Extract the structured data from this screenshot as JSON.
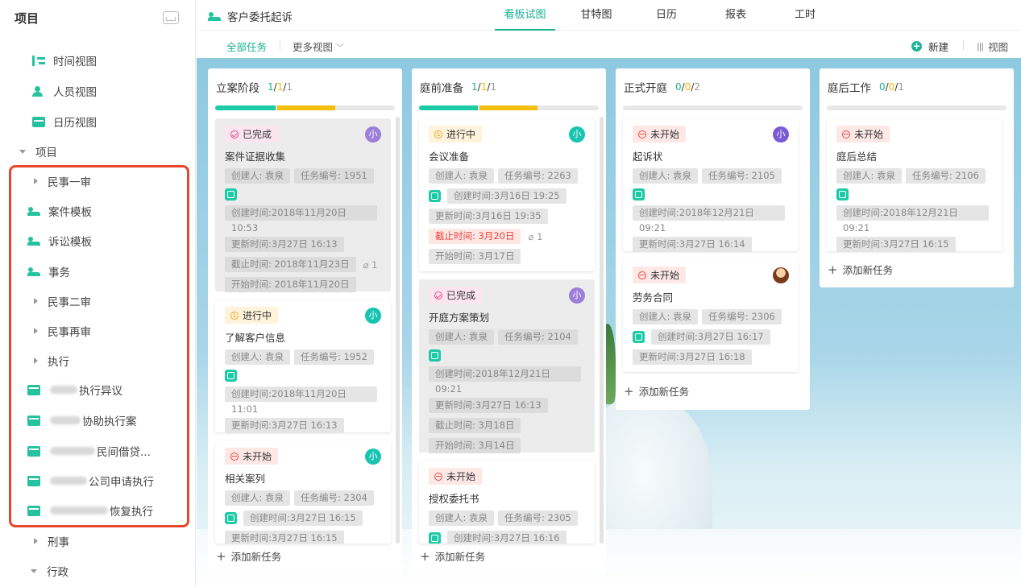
{
  "sidebar": {
    "title": "项目",
    "views": [
      {
        "label": "时间视图",
        "icon": "timeline-icon"
      },
      {
        "label": "人员视图",
        "icon": "people-icon"
      },
      {
        "label": "日历视图",
        "icon": "calendar-icon"
      }
    ],
    "project_group_label": "项目",
    "items": [
      {
        "label": "民事一审",
        "type": "group"
      },
      {
        "label": "案件模板",
        "type": "project"
      },
      {
        "label": "诉讼模板",
        "type": "project"
      },
      {
        "label": "事务",
        "type": "project"
      },
      {
        "label": "民事二审",
        "type": "group"
      },
      {
        "label": "民事再审",
        "type": "group"
      },
      {
        "label": "执行",
        "type": "group"
      },
      {
        "label": "执行异议",
        "type": "folder"
      },
      {
        "label": "协助执行案",
        "type": "folder"
      },
      {
        "label": "民间借贷...",
        "type": "folder"
      },
      {
        "label": "公司申请执行",
        "type": "folder"
      },
      {
        "label": "恢复执行",
        "type": "folder"
      }
    ],
    "footer_groups": [
      {
        "label": "刑事"
      },
      {
        "label": "行政"
      }
    ]
  },
  "header": {
    "project_name": "客户委托起诉",
    "tabs": [
      {
        "label": "看板试图",
        "active": true
      },
      {
        "label": "甘特图",
        "active": false
      },
      {
        "label": "日历",
        "active": false
      },
      {
        "label": "报表",
        "active": false
      },
      {
        "label": "工时",
        "active": false
      }
    ]
  },
  "subbar": {
    "all_tasks": "全部任务",
    "more_views": "更多视图",
    "new_label": "新建",
    "view_label": "视图"
  },
  "board": {
    "add_task_label": "添加新任务",
    "columns": [
      {
        "name": "立案阶段",
        "count": {
          "a": "1",
          "b": "1",
          "c": "1"
        },
        "progress": {
          "green": 0.33,
          "yellow": 0.33
        },
        "cards": [
          {
            "status": "已完成",
            "title": "案件证据收集",
            "creator": "创建人: 袁泉",
            "task_no": "任务编号: 1951",
            "created": "创建时间:2018年11月20日 10:53",
            "updated": "更新时间:3月27日 16:13",
            "deadline": "截止时间: 2018年11月23日",
            "attach": "1",
            "start": "开始时间: 2018年11月20日",
            "avatar": "小"
          },
          {
            "status": "进行中",
            "title": "了解客户信息",
            "creator": "创建人: 袁泉",
            "task_no": "任务编号: 1952",
            "created": "创建时间:2018年11月20日 11:01",
            "updated": "更新时间:3月27日 16:13",
            "avatar": "小"
          },
          {
            "status": "未开始",
            "title": "相关案列",
            "creator": "创建人: 袁泉",
            "task_no": "任务编号: 2304",
            "created": "创建时间:3月27日 16:15",
            "updated": "更新时间:3月27日 16:15",
            "avatar": "小"
          }
        ]
      },
      {
        "name": "庭前准备",
        "count": {
          "a": "1",
          "b": "1",
          "c": "1"
        },
        "progress": {
          "green": 0.33,
          "yellow": 0.33
        },
        "cards": [
          {
            "status": "进行中",
            "title": "会议准备",
            "creator": "创建人: 袁泉",
            "task_no": "任务编号: 2263",
            "created": "创建时间:3月16日 19:25",
            "updated": "更新时间:3月16日 19:35",
            "deadline": "截止时间: 3月20日",
            "attach": "1",
            "start": "开始时间: 3月17日",
            "avatar": "小"
          },
          {
            "status": "已完成",
            "title": "开庭方案策划",
            "creator": "创建人: 袁泉",
            "task_no": "任务编号: 2104",
            "created": "创建时间:2018年12月21日 09:21",
            "updated": "更新时间:3月27日 16:13",
            "deadline": "截止时间: 3月18日",
            "start": "开始时间: 3月14日",
            "avatar": "小"
          },
          {
            "status": "未开始",
            "title": "授权委托书",
            "creator": "创建人: 袁泉",
            "task_no": "任务编号: 2305",
            "created": "创建时间:3月27日 16:16",
            "avatar": ""
          }
        ]
      },
      {
        "name": "正式开庭",
        "count": {
          "a": "0",
          "b": "0",
          "c": "2"
        },
        "progress": {
          "green": 0,
          "yellow": 0
        },
        "cards": [
          {
            "status": "未开始",
            "title": "起诉状",
            "creator": "创建人: 袁泉",
            "task_no": "任务编号: 2105",
            "created": "创建时间:2018年12月21日 09:21",
            "updated": "更新时间:3月27日 16:14",
            "avatar": "小"
          },
          {
            "status": "未开始",
            "title": "劳务合同",
            "creator": "创建人: 袁泉",
            "task_no": "任务编号: 2306",
            "created": "创建时间:3月27日 16:17",
            "updated": "更新时间:3月27日 16:18",
            "avatar": ""
          }
        ]
      },
      {
        "name": "庭后工作",
        "count": {
          "a": "0",
          "b": "0",
          "c": "1"
        },
        "progress": {
          "green": 0,
          "yellow": 0
        },
        "cards": [
          {
            "status": "未开始",
            "title": "庭后总结",
            "creator": "创建人: 袁泉",
            "task_no": "任务编号: 2106",
            "created": "创建时间:2018年12月21日 09:21",
            "updated": "更新时间:3月27日 16:15",
            "avatar": ""
          }
        ]
      }
    ]
  },
  "colors": {
    "accent": "#1ab394",
    "highlight_box": "#e8462c",
    "progress_green": "#1ccaa6",
    "progress_yellow": "#f5be0b"
  }
}
